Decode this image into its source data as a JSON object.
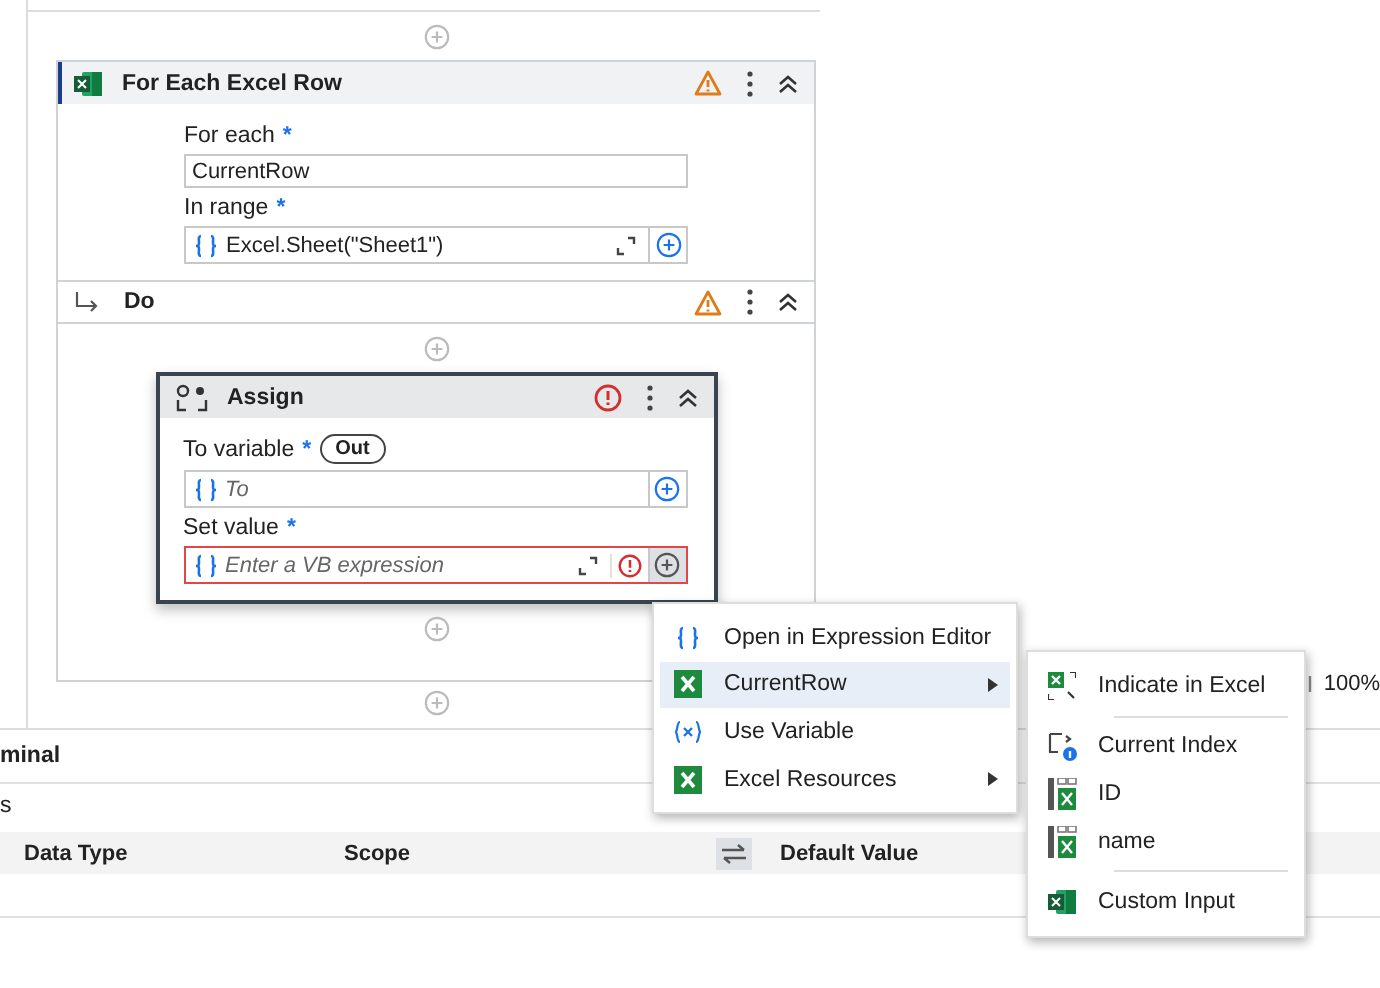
{
  "canvas": {
    "zoom": "100%"
  },
  "for_each_activity": {
    "title": "For Each Excel Row",
    "warning": true,
    "fields": [
      {
        "label": "For each",
        "required": "*",
        "kind": "text",
        "value": "CurrentRow"
      },
      {
        "label": "In range",
        "required": "*",
        "kind": "expression",
        "value": "Excel.Sheet(\"Sheet1\")"
      }
    ]
  },
  "do_section": {
    "title": "Do",
    "warning": true
  },
  "assign_activity": {
    "title": "Assign",
    "error": true,
    "fields": [
      {
        "label": "To variable",
        "required": "*",
        "badge": "Out",
        "placeholder": "To",
        "error": false
      },
      {
        "label": "Set value",
        "required": "*",
        "placeholder": "Enter a VB expression",
        "error": true
      }
    ]
  },
  "context_menu": {
    "items": [
      {
        "label": "Open in Expression Editor",
        "kind": "expression",
        "submenu": false,
        "selected": false
      },
      {
        "label": "CurrentRow",
        "kind": "excel",
        "submenu": true,
        "selected": true
      },
      {
        "label": "Use Variable",
        "kind": "variable",
        "submenu": false,
        "selected": false
      },
      {
        "label": "Excel Resources",
        "kind": "excel",
        "submenu": true,
        "selected": false
      }
    ]
  },
  "submenu": {
    "groups": [
      [
        {
          "label": "Indicate in Excel",
          "kind": "indicate"
        }
      ],
      [
        {
          "label": "Current Index",
          "kind": "index"
        },
        {
          "label": "ID",
          "kind": "column"
        },
        {
          "label": "name",
          "kind": "column"
        }
      ],
      [
        {
          "label": "Custom Input",
          "kind": "custom"
        }
      ]
    ]
  },
  "bottom_panel": {
    "tab": "minal",
    "section": "s",
    "columns": [
      "Data Type",
      "Scope",
      "Default Value"
    ]
  }
}
